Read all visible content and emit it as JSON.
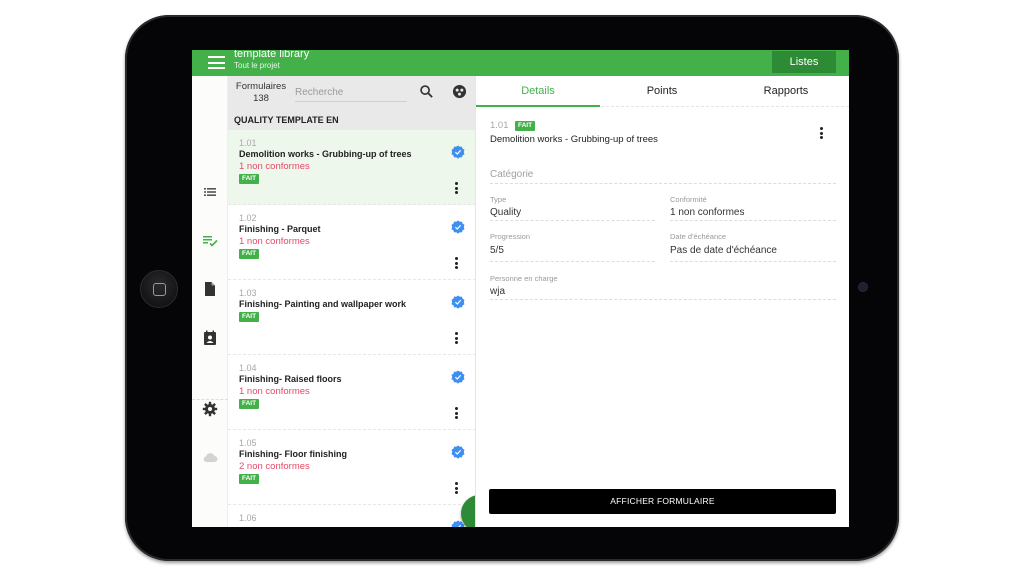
{
  "app": {
    "title": "template library",
    "subtitle": "Tout le projet",
    "listes_button": "Listes"
  },
  "colors": {
    "primary_green": "#43b049",
    "dark_green": "#2e8b35",
    "nonconform_red": "#e84a6a",
    "verified_blue": "#3d8ff0"
  },
  "rail": {
    "items": [
      {
        "icon": "list-icon",
        "active": false
      },
      {
        "icon": "checklist-icon",
        "active": true
      },
      {
        "icon": "document-icon",
        "active": false
      },
      {
        "icon": "contact-card-icon",
        "active": false
      },
      {
        "icon": "gear-icon",
        "active": false
      },
      {
        "icon": "cloud-icon",
        "active": false
      }
    ]
  },
  "list": {
    "count_label": "Formulaires",
    "count": "138",
    "search_placeholder": "Recherche",
    "search_value": "",
    "section_title": "QUALITY TEMPLATE EN",
    "items": [
      {
        "num": "1.01",
        "title": "Demolition works - Grubbing-up of trees",
        "nonconform": "1 non conformes",
        "badge": "FAIT",
        "selected": true
      },
      {
        "num": "1.02",
        "title": "Finishing - Parquet",
        "nonconform": "1 non conformes",
        "badge": "FAIT",
        "selected": false
      },
      {
        "num": "1.03",
        "title": "Finishing- Painting and wallpaper work",
        "nonconform": "",
        "badge": "FAIT",
        "selected": false
      },
      {
        "num": "1.04",
        "title": "Finishing- Raised floors",
        "nonconform": "1 non conformes",
        "badge": "FAIT",
        "selected": false
      },
      {
        "num": "1.05",
        "title": "Finishing- Floor finishing",
        "nonconform": "2 non conformes",
        "badge": "FAIT",
        "selected": false
      },
      {
        "num": "1.06",
        "title": "",
        "nonconform": "",
        "badge": "",
        "selected": false
      }
    ],
    "fab_label": "+"
  },
  "detail": {
    "tabs": [
      {
        "label": "Details",
        "active": true
      },
      {
        "label": "Points",
        "active": false
      },
      {
        "label": "Rapports",
        "active": false
      }
    ],
    "num": "1.01",
    "badge": "FAIT",
    "title": "Demolition works - Grubbing-up of trees",
    "category_placeholder": "Catégorie",
    "fields": {
      "type": {
        "label": "Type",
        "value": "Quality"
      },
      "conformite": {
        "label": "Conformité",
        "value": "1 non conformes"
      },
      "progression": {
        "label": "Progression",
        "value": "5/5"
      },
      "echeance": {
        "label": "Date d'échéance",
        "value": "Pas de date d'échéance"
      },
      "personne": {
        "label": "Personne en charge",
        "value": "wja"
      }
    },
    "afficher_button": "AFFICHER FORMULAIRE"
  }
}
